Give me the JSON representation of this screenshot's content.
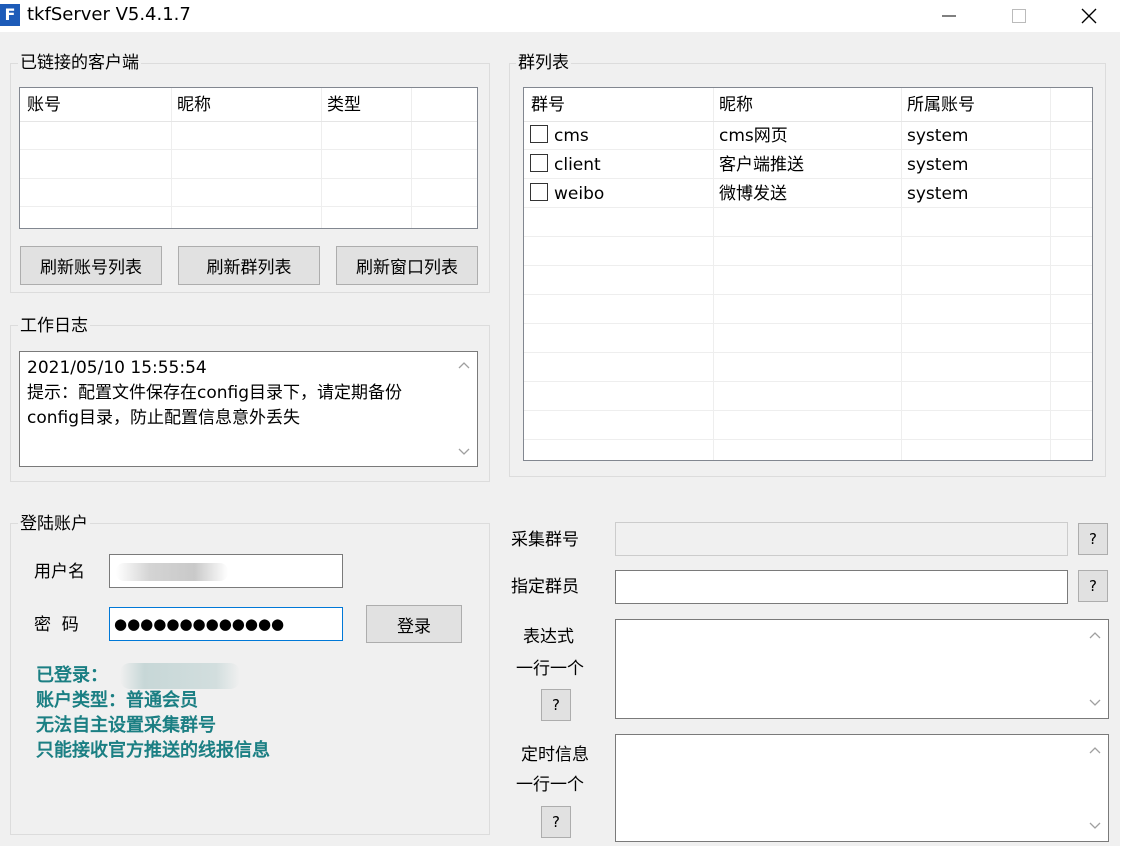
{
  "window": {
    "icon_letter": "F",
    "title": "tkfServer  V5.4.1.7"
  },
  "clients": {
    "group_title": "已链接的客户端",
    "columns": [
      "账号",
      "昵称",
      "类型"
    ],
    "buttons": {
      "refresh_accounts": "刷新账号列表",
      "refresh_groups": "刷新群列表",
      "refresh_windows": "刷新窗口列表"
    }
  },
  "log": {
    "group_title": "工作日志",
    "lines": [
      "2021/05/10 15:55:54",
      "提示：配置文件保存在config目录下，请定期备份",
      "config目录，防止配置信息意外丢失"
    ]
  },
  "groups": {
    "group_title": "群列表",
    "columns": [
      "群号",
      "昵称",
      "所属账号"
    ],
    "rows": [
      {
        "id": "cms",
        "nickname": "cms网页",
        "owner": "system",
        "checked": false
      },
      {
        "id": "client",
        "nickname": "客户端推送",
        "owner": "system",
        "checked": false
      },
      {
        "id": "weibo",
        "nickname": "微博发送",
        "owner": "system",
        "checked": false
      }
    ]
  },
  "login": {
    "group_title": "登陆账户",
    "username_label": "用户名",
    "password_label": "密  码",
    "password_value": "●●●●●●●●●●●●●",
    "login_button": "登录",
    "status": {
      "logged_in": "已登录：",
      "account_type": "账户类型：普通会员",
      "note1": "无法自主设置采集群号",
      "note2": "只能接收官方推送的线报信息"
    }
  },
  "config": {
    "collect_group_label": "采集群号",
    "designated_member_label": "指定群员",
    "expression_label": "表达式",
    "expression_hint": "一行一个",
    "timed_message_label": "定时信息",
    "timed_message_hint": "一行一个",
    "help_label": "?"
  },
  "colors": {
    "status_text": "#1b7f83",
    "focus_border": "#0078d7",
    "icon_bg": "#1d5bb8"
  }
}
